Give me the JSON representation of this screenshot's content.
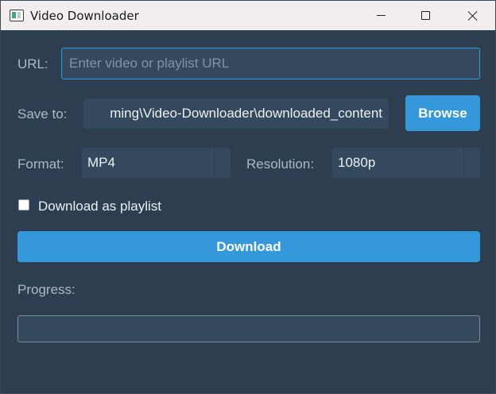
{
  "window": {
    "title": "Video Downloader",
    "controls": {
      "minimize": "minimize-icon",
      "maximize": "maximize-icon",
      "close": "close-icon"
    }
  },
  "url": {
    "label": "URL:",
    "value": "",
    "placeholder": "Enter video or playlist URL"
  },
  "save_to": {
    "label": "Save to:",
    "value": "ming\\Video-Downloader\\downloaded_content",
    "browse_label": "Browse"
  },
  "format": {
    "label": "Format:",
    "selected": "MP4"
  },
  "resolution": {
    "label": "Resolution:",
    "selected": "1080p"
  },
  "playlist": {
    "label": "Download as playlist",
    "checked": false
  },
  "download": {
    "label": "Download"
  },
  "progress": {
    "label": "Progress:",
    "value": 0
  },
  "colors": {
    "background": "#2c3e50",
    "field": "#34495e",
    "accent": "#3498db",
    "label": "#aeb8c2",
    "text": "#ecf0f1"
  }
}
